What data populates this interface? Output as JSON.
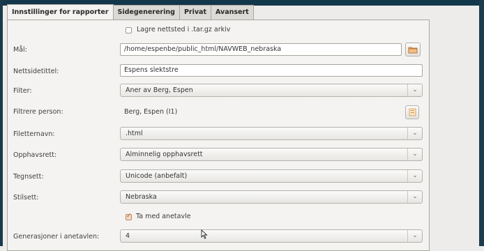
{
  "tabs": [
    {
      "label": "Innstillinger for rapporter",
      "active": true
    },
    {
      "label": "Sidegenerering",
      "active": false
    },
    {
      "label": "Privat",
      "active": false
    },
    {
      "label": "Avansert",
      "active": false
    }
  ],
  "archive_checkbox": {
    "label": "Lagre nettsted i .tar.gz arkiv",
    "checked": false
  },
  "form": {
    "target": {
      "label": "Mål:",
      "value": "/home/espenbe/public_html/NAVWEB_nebraska"
    },
    "site_title": {
      "label": "Nettsidetittel:",
      "value": "Espens slektstre"
    },
    "filter": {
      "label": "Filter:",
      "value": "Aner av Berg, Espen"
    },
    "filter_person": {
      "label": "Filtrere person:",
      "value": "Berg, Espen (I1)"
    },
    "extension": {
      "label": "Filetternavn:",
      "value": ".html"
    },
    "copyright": {
      "label": "Opphavsrett:",
      "value": "Alminnelig opphavsrett"
    },
    "encoding": {
      "label": "Tegnsett:",
      "value": "Unicode (anbefalt)"
    },
    "stylesheet": {
      "label": "Stilsett:",
      "value": "Nebraska"
    },
    "ancestor_tree_checkbox": {
      "label": "Ta med anetavle",
      "checked": true
    },
    "generations": {
      "label": "Generasjoner i anetavlen:",
      "value": "4"
    }
  },
  "icons": {
    "folder": "folder-icon",
    "person_select": "person-select-icon",
    "dropdown": "chevron-down-icon",
    "cursor": "mouse-pointer-icon"
  },
  "colors": {
    "background": "#f4f3f1",
    "frame": "#13374a",
    "check_accent": "#c0551a"
  }
}
